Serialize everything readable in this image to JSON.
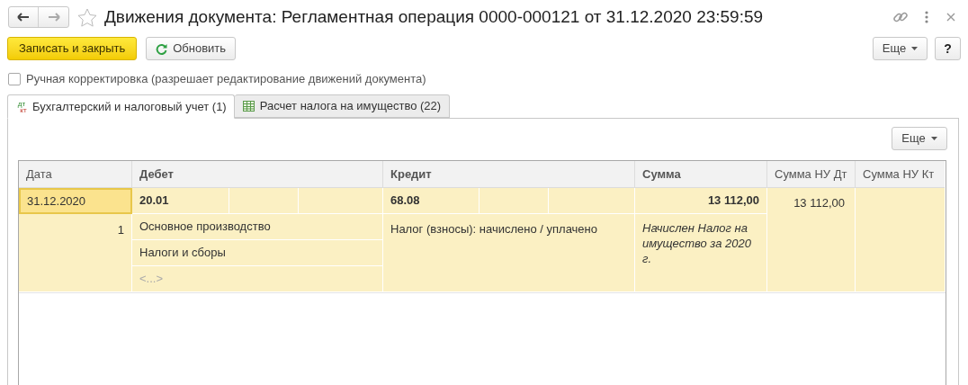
{
  "window": {
    "title": "Движения документа: Регламентная операция 0000-000121 от 31.12.2020 23:59:59",
    "favorite": false
  },
  "toolbar": {
    "save_close": "Записать и закрыть",
    "refresh": "Обновить",
    "more": "Еще",
    "help": "?"
  },
  "manual_edit": {
    "label": "Ручная корректировка (разрешает редактирование движений документа)",
    "checked": false
  },
  "tabs": [
    {
      "label": "Бухгалтерский и налоговый учет (1)",
      "kind": "dtkt",
      "icon_top": "дт",
      "icon_bottom": "кт",
      "selected": true
    },
    {
      "label": "Расчет налога на имущество (22)",
      "kind": "table",
      "selected": false
    }
  ],
  "table_more": "Еще",
  "table": {
    "columns": [
      "Дата",
      "Дебет",
      "Кредит",
      "Сумма",
      "Сумма НУ Дт",
      "Сумма НУ Кт"
    ],
    "rows": [
      {
        "selected": true,
        "date": "31.12.2020",
        "number": "1",
        "debit": {
          "account": "20.01",
          "subconto": [
            {
              "text": "Основное производство",
              "empty": false
            },
            {
              "text": "Налоги и сборы",
              "empty": false
            },
            {
              "text": "<...>",
              "empty": true
            }
          ]
        },
        "credit": {
          "account": "68.08",
          "subconto": [
            {
              "text": "Налог (взносы): начислено / уплачено",
              "empty": false
            }
          ]
        },
        "amount": "13 112,00",
        "content": "Начислен Налог на имущество за 2020 г.",
        "amount_tax_dt": "13 112,00"
      }
    ]
  }
}
